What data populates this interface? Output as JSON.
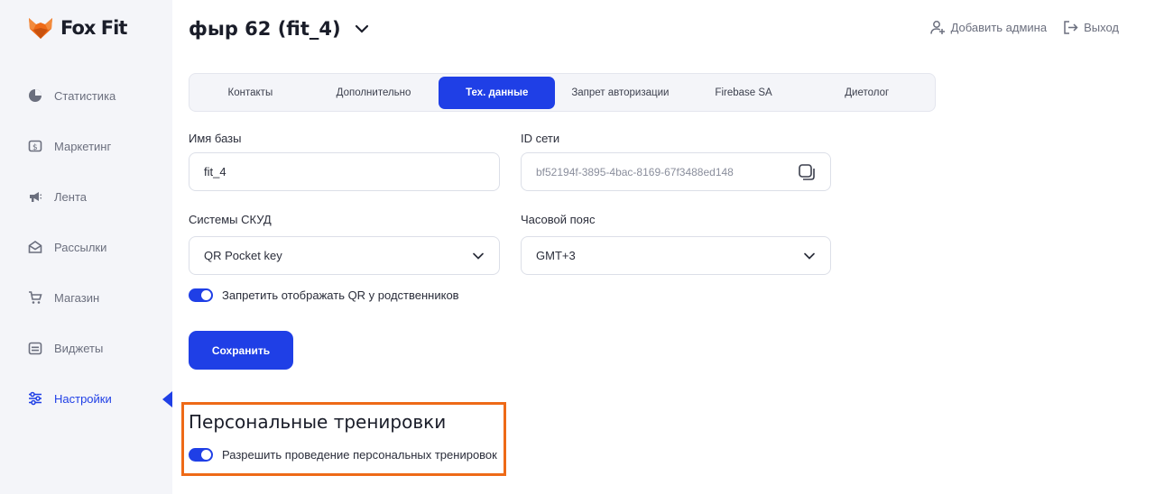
{
  "brand": {
    "name": "Fox Fit",
    "logo_color": "#ee6a17"
  },
  "sidebar": {
    "items": [
      {
        "label": "Статистика",
        "icon": "pie-chart-icon"
      },
      {
        "label": "Маркетинг",
        "icon": "coupon-icon"
      },
      {
        "label": "Лента",
        "icon": "megaphone-icon"
      },
      {
        "label": "Рассылки",
        "icon": "envelope-icon"
      },
      {
        "label": "Магазин",
        "icon": "cart-icon"
      },
      {
        "label": "Виджеты",
        "icon": "calendar-icon"
      },
      {
        "label": "Настройки",
        "icon": "sliders-icon",
        "active": true
      }
    ]
  },
  "header": {
    "title": "фыр 62 (fit_4)",
    "add_admin": "Добавить админа",
    "logout": "Выход"
  },
  "tabs": [
    {
      "label": "Контакты"
    },
    {
      "label": "Дополнительно"
    },
    {
      "label": "Тех. данные",
      "active": true
    },
    {
      "label": "Запрет авторизации"
    },
    {
      "label": "Firebase SA"
    },
    {
      "label": "Диетолог"
    }
  ],
  "form": {
    "db_name": {
      "label": "Имя базы",
      "value": "fit_4"
    },
    "network_id": {
      "label": "ID сети",
      "value": "bf52194f-3895-4bac-8169-67f3488ed148"
    },
    "access_system": {
      "label": "Системы СКУД",
      "value": "QR Pocket key"
    },
    "timezone": {
      "label": "Часовой пояс",
      "value": "GMT+3"
    },
    "qr_toggle": {
      "label": "Запретить отображать QR у родственников",
      "on": true
    },
    "save_label": "Сохранить"
  },
  "personal_training": {
    "title": "Персональные тренировки",
    "toggle": {
      "label": "Разрешить проведение персональных тренировок",
      "on": true
    }
  },
  "colors": {
    "accent": "#1f3fe6",
    "highlight": "#ee6a17",
    "sidebar_bg": "#f4f5f9"
  }
}
